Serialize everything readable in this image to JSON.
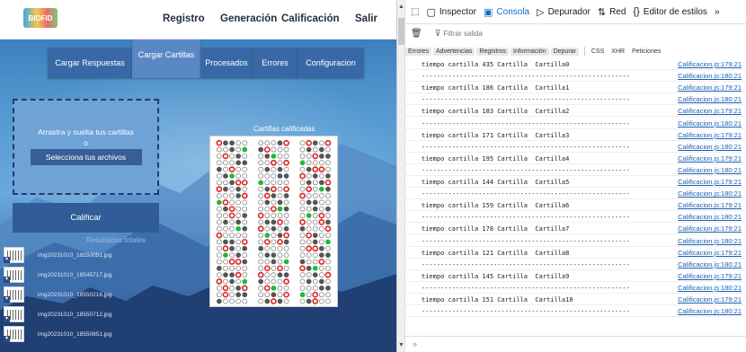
{
  "navbar": {
    "logo_text": "BIOFID",
    "links": [
      "Registro",
      "Generación",
      "Calificación",
      "Salir"
    ]
  },
  "tabs": [
    "Cargar Respuestas",
    "Cargar Cartillas",
    "Procesados",
    "Errores",
    "Configuracion"
  ],
  "active_tab": "Cargar Cartillas",
  "dropzone": {
    "text": "Arrastra y suelta tus cartillas",
    "or": "o",
    "button": "Selecciona tus archivos"
  },
  "grade_button": "Calificar",
  "results_label": "Resultados totales",
  "files": [
    "img20231010_18550051.jpg",
    "img20231010_18545717.jpg",
    "img20231010_18550216.jpg",
    "img20231010_18550712.jpg",
    "img20231010_18550851.jpg"
  ],
  "sheet_title": "Cartillas calificadas",
  "colors": {
    "accent_tab": "#3869a6",
    "correct": "#22b83a",
    "wrong": "#e02020",
    "filled": "#555555",
    "link": "#1a5fb4"
  },
  "devtools": {
    "tabs": [
      {
        "icon": "▢",
        "label": "Inspector"
      },
      {
        "icon": "▣",
        "label": "Consola"
      },
      {
        "icon": "▷",
        "label": "Depurador"
      },
      {
        "icon": "⇅",
        "label": "Red"
      },
      {
        "icon": "{}",
        "label": "Editor de estilos"
      }
    ],
    "active": "Consola",
    "overflow": "»",
    "filter_placeholder": "Filtrar salida",
    "levels": [
      "Errores",
      "Advertencias",
      "Registros",
      "Información",
      "Depurar",
      "CSS",
      "XHR",
      "Peticiones"
    ],
    "log": [
      {
        "text": "tiempo cartilla 435 Cartilla  Cartilla0",
        "src": "Calificacion.js:179:21"
      },
      {
        "text": "-------------------------------------------------------",
        "src": "Calificacion.js:180:21"
      },
      {
        "text": "tiempo cartilla 186 Cartilla  Cartilla1",
        "src": "Calificacion.js:179:21"
      },
      {
        "text": "-------------------------------------------------------",
        "src": "Calificacion.js:180:21"
      },
      {
        "text": "tiempo cartilla 183 Cartilla  Cartilla2",
        "src": "Calificacion.js:179:21"
      },
      {
        "text": "-------------------------------------------------------",
        "src": "Calificacion.js:180:21"
      },
      {
        "text": "tiempo cartilla 171 Cartilla  Cartilla3",
        "src": "Calificacion.js:179:21"
      },
      {
        "text": "-------------------------------------------------------",
        "src": "Calificacion.js:180:21"
      },
      {
        "text": "tiempo cartilla 195 Cartilla  Cartilla4",
        "src": "Calificacion.js:179:21"
      },
      {
        "text": "-------------------------------------------------------",
        "src": "Calificacion.js:180:21"
      },
      {
        "text": "tiempo cartilla 144 Cartilla  Cartilla5",
        "src": "Calificacion.js:179:21"
      },
      {
        "text": "-------------------------------------------------------",
        "src": "Calificacion.js:180:21"
      },
      {
        "text": "tiempo cartilla 159 Cartilla  Cartilla6",
        "src": "Calificacion.js:179:21"
      },
      {
        "text": "-------------------------------------------------------",
        "src": "Calificacion.js:180:21"
      },
      {
        "text": "tiempo cartilla 178 Cartilla  Cartilla7",
        "src": "Calificacion.js:179:21"
      },
      {
        "text": "-------------------------------------------------------",
        "src": "Calificacion.js:180:21"
      },
      {
        "text": "tiempo cartilla 121 Cartilla  Cartilla8",
        "src": "Calificacion.js:179:21"
      },
      {
        "text": "-------------------------------------------------------",
        "src": "Calificacion.js:180:21"
      },
      {
        "text": "tiempo cartilla 145 Cartilla  Cartilla9",
        "src": "Calificacion.js:179:21"
      },
      {
        "text": "-------------------------------------------------------",
        "src": "Calificacion.js:180:21"
      },
      {
        "text": "tiempo cartilla 151 Cartilla  Cartilla10",
        "src": "Calificacion.js:179:21"
      },
      {
        "text": "-------------------------------------------------------",
        "src": "Calificacion.js:180:21"
      }
    ]
  }
}
